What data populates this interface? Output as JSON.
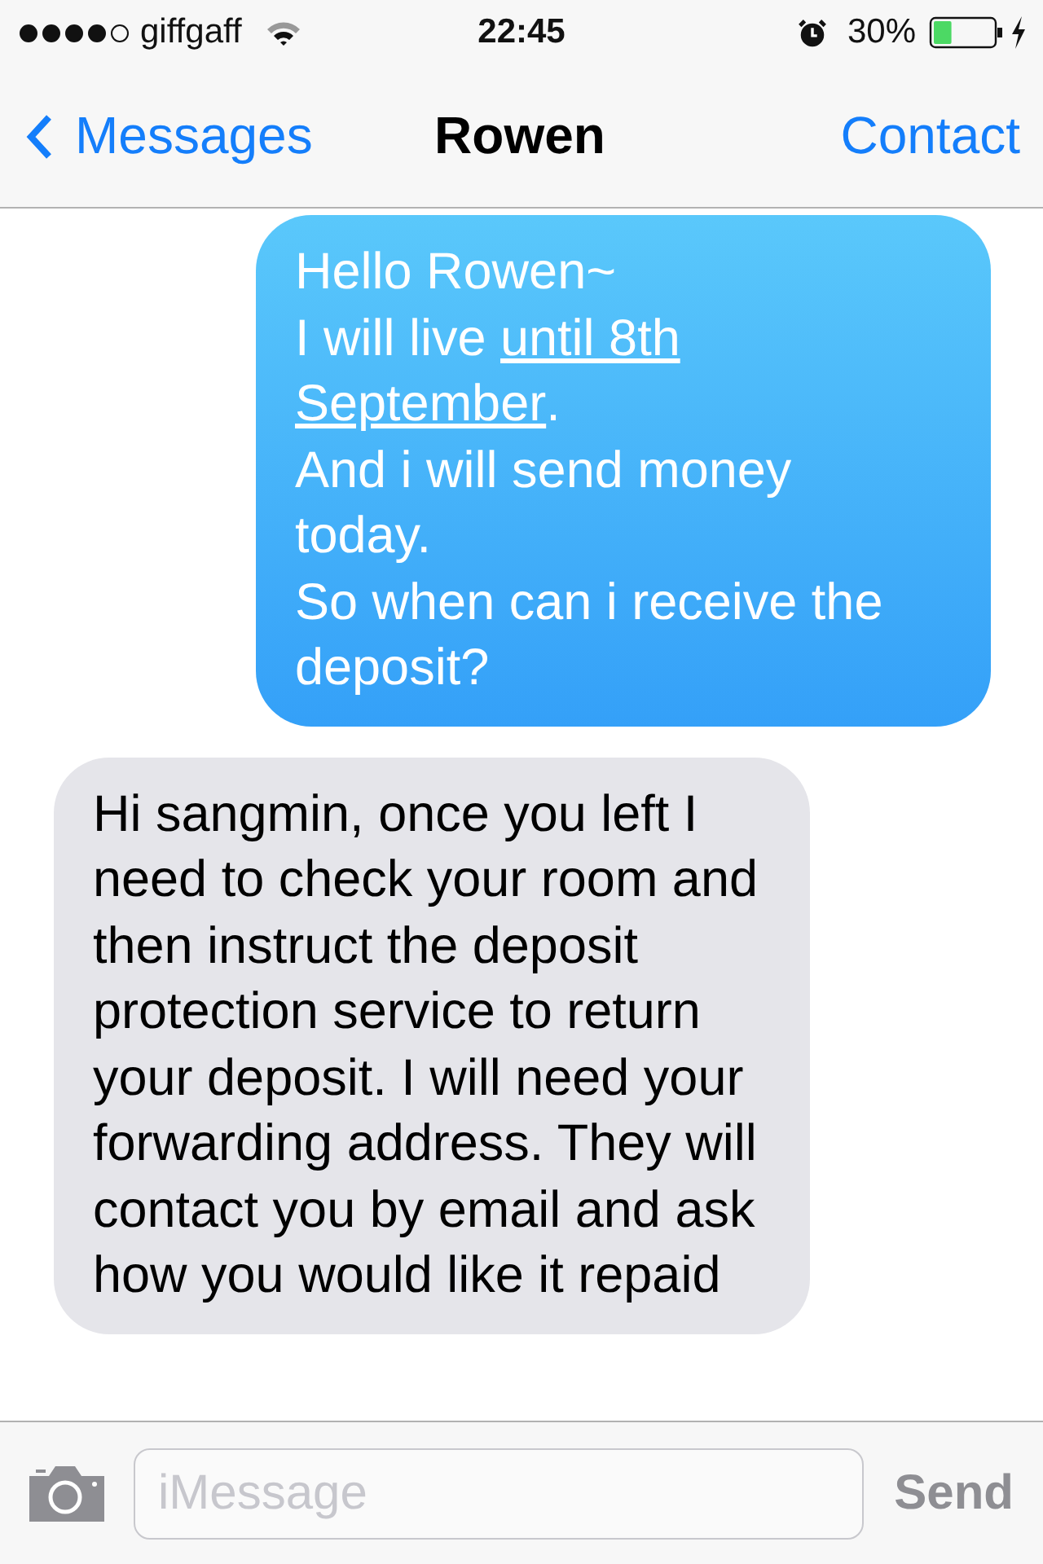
{
  "status_bar": {
    "carrier": "giffgaff",
    "time": "22:45",
    "battery": "30%"
  },
  "nav": {
    "back": "Messages",
    "title": "Rowen",
    "action": "Contact"
  },
  "messages": [
    {
      "kind": "sent",
      "parts": [
        {
          "text": "Hello Rowen~\nI will live ",
          "link": false
        },
        {
          "text": "until 8th ",
          "link": true
        },
        {
          "text": "September",
          "link": true
        },
        {
          "text": ".\nAnd i will send money today.\nSo when can i receive the deposit?",
          "link": false
        }
      ]
    },
    {
      "kind": "received",
      "parts": [
        {
          "text": "Hi sangmin, once you left I need to check your room and then instruct the deposit protection service to return your deposit. I will need your forwarding address. They will contact you by email and ask how you would like it repaid",
          "link": false
        }
      ]
    }
  ],
  "composer": {
    "placeholder": "iMessage",
    "send": "Send"
  }
}
